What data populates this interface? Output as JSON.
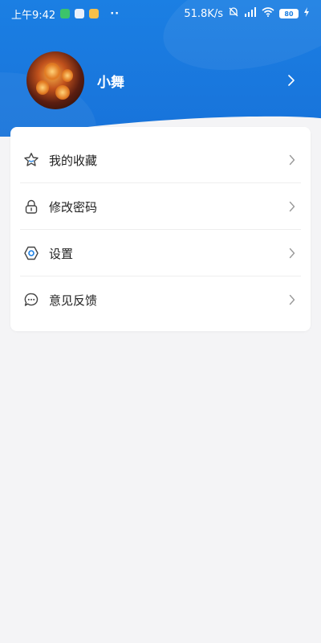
{
  "status_bar": {
    "time": "上午9:42",
    "dots": "··",
    "network_speed": "51.8K/s",
    "battery": "80"
  },
  "profile": {
    "username": "小舞"
  },
  "menu": {
    "items": [
      {
        "label": "我的收藏",
        "icon": "star-icon"
      },
      {
        "label": "修改密码",
        "icon": "lock-icon"
      },
      {
        "label": "设置",
        "icon": "settings-hexagon-icon"
      },
      {
        "label": "意见反馈",
        "icon": "feedback-chat-icon"
      }
    ]
  },
  "colors": {
    "header_blue": "#1b7fe3",
    "page_bg": "#f4f4f6",
    "icon_gray": "#444444",
    "chevron_gray": "#999999"
  }
}
